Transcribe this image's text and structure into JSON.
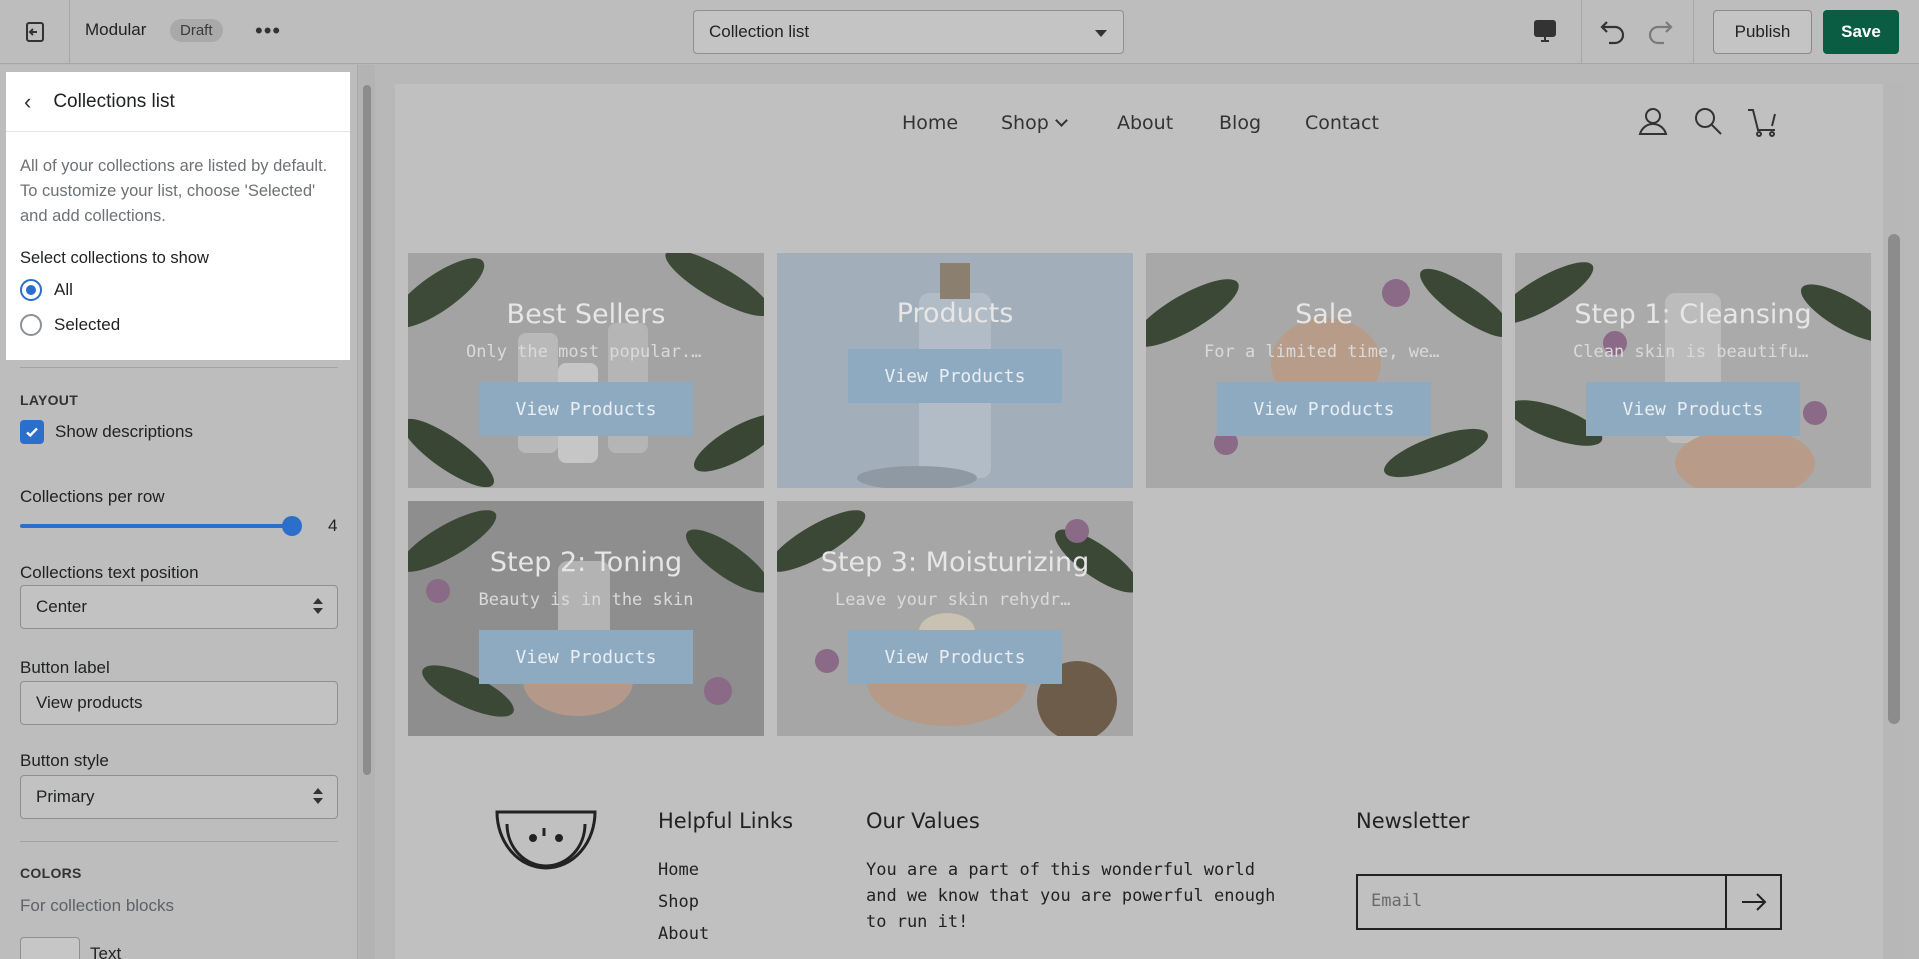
{
  "topbar": {
    "theme_name": "Modular",
    "status_badge": "Draft",
    "more_label": "•••",
    "template_select": "Collection list",
    "publish_label": "Publish",
    "save_label": "Save"
  },
  "sidebar": {
    "back_label": "‹",
    "title": "Collections list",
    "description": "All of your collections are listed by default. To customize your list, choose 'Selected' and add collections.",
    "select_label": "Select collections to show",
    "options": [
      {
        "label": "All",
        "selected": true
      },
      {
        "label": "Selected",
        "selected": false
      }
    ],
    "layout_heading": "LAYOUT",
    "show_descriptions_label": "Show descriptions",
    "show_descriptions_checked": true,
    "per_row_label": "Collections per row",
    "per_row_value": "4",
    "per_row_fraction": 1.0,
    "text_position_label": "Collections text position",
    "text_position_value": "Center",
    "button_label_label": "Button label",
    "button_label_value": "View products",
    "button_style_label": "Button style",
    "button_style_value": "Primary",
    "colors_heading": "COLORS",
    "colors_sub": "For collection blocks",
    "text_color_label": "Text"
  },
  "store": {
    "nav": [
      {
        "label": "Home"
      },
      {
        "label": "Shop",
        "has_dropdown": true
      },
      {
        "label": "About"
      },
      {
        "label": "Blog"
      },
      {
        "label": "Contact"
      }
    ],
    "collections": [
      {
        "title": "Best Sellers",
        "desc": "Only the most popular...",
        "button": "View Products",
        "image": "bottles-leaves"
      },
      {
        "title": "Products",
        "desc": "",
        "button": "View Products",
        "image": "pump-bottle"
      },
      {
        "title": "Sale",
        "desc": "For a limited time, we're...",
        "button": "View Products",
        "image": "hand-flowers"
      },
      {
        "title": "Step 1: Cleansing",
        "desc": "Clean skin is beautiful, glowi...",
        "button": "View Products",
        "image": "hand-bottle"
      },
      {
        "title": "Step 2: Toning",
        "desc": "Beauty is in the skin",
        "button": "View Products",
        "image": "hand-toner"
      },
      {
        "title": "Step 3: Moisturizing",
        "desc": "Leave your skin rehydrated...",
        "button": "View Products",
        "image": "hands-jar"
      }
    ],
    "footer": {
      "helpful_title": "Helpful Links",
      "helpful_links": [
        "Home",
        "Shop",
        "About"
      ],
      "values_title": "Our Values",
      "values_text": "You are a part of this wonderful world and we know that you are powerful enough to run it!",
      "newsletter_title": "Newsletter",
      "email_placeholder": "Email"
    }
  },
  "colors": {
    "accent": "#2c6ecb",
    "save_button": "#0a5c43",
    "tile_button": "#8eaac0"
  }
}
